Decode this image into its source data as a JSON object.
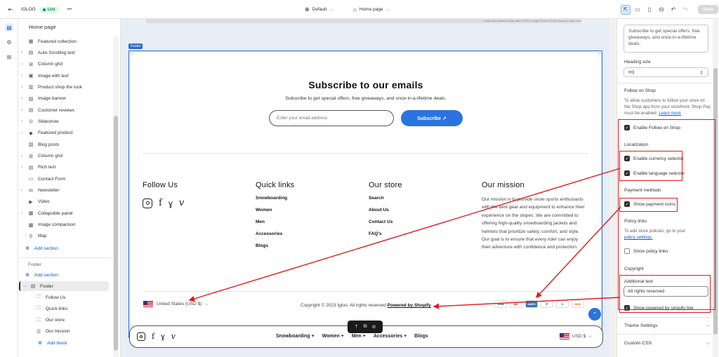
{
  "topbar": {
    "store_name": "IGLOO",
    "live_label": "Live",
    "more": "•••",
    "theme_label": "Default",
    "page_label": "Home page",
    "save_label": "Save"
  },
  "left_panel": {
    "title": "Home page",
    "items": [
      {
        "label": "Featured collection",
        "icon": "collection-icon",
        "glyph": "▦",
        "expandable": false
      },
      {
        "label": "Auto-Scrolling text",
        "icon": "text-icon",
        "glyph": "▤",
        "expandable": true
      },
      {
        "label": "Column grid",
        "icon": "grid-icon",
        "glyph": "⊞",
        "expandable": true
      },
      {
        "label": "Image with text",
        "icon": "image-text-icon",
        "glyph": "▣",
        "expandable": true
      },
      {
        "label": "Product shop the look",
        "icon": "product-icon",
        "glyph": "▥",
        "expandable": true
      },
      {
        "label": "Image banner",
        "icon": "image-icon",
        "glyph": "▨",
        "expandable": true
      },
      {
        "label": "Customer reviews",
        "icon": "reviews-icon",
        "glyph": "▤",
        "expandable": true
      },
      {
        "label": "Slideshow",
        "icon": "slideshow-icon",
        "glyph": "◎",
        "expandable": true
      },
      {
        "label": "Featured product",
        "icon": "tag-icon",
        "glyph": "◆",
        "expandable": true
      },
      {
        "label": "Blog posts",
        "icon": "blog-icon",
        "glyph": "▧",
        "expandable": false
      },
      {
        "label": "Column grid",
        "icon": "grid-icon",
        "glyph": "⊞",
        "expandable": true
      },
      {
        "label": "Rich text",
        "icon": "richtext-icon",
        "glyph": "▤",
        "expandable": true
      },
      {
        "label": "Contact Form",
        "icon": "form-icon",
        "glyph": "▭",
        "expandable": false
      },
      {
        "label": "Newsletter",
        "icon": "mail-icon",
        "glyph": "✉",
        "expandable": true
      },
      {
        "label": "Video",
        "icon": "video-icon",
        "glyph": "▶",
        "expandable": false
      },
      {
        "label": "Collapsible panel",
        "icon": "panel-icon",
        "glyph": "▦",
        "expandable": true
      },
      {
        "label": "Image comparison",
        "icon": "compare-icon",
        "glyph": "▩",
        "expandable": false
      },
      {
        "label": "Map",
        "icon": "map-pin-icon",
        "glyph": "⚲",
        "expandable": false
      }
    ],
    "add_section": "Add section",
    "footer_group_label": "Footer",
    "footer_add_section": "Add section",
    "footer_item": "Footer",
    "footer_blocks": [
      "Follow Us",
      "Quick links",
      "Our store",
      "Our mission"
    ],
    "add_block": "Add block"
  },
  "preview": {
    "map_attribution": "Keyboard shortcuts   Map data ©2023 Google   Terms of Use   Report a map error",
    "footer_tag": "Footer",
    "subscribe_title": "Subscribe to our emails",
    "subscribe_desc": "Subscribe to get special offers, free giveaways, and once-in-a-lifetime deals.",
    "email_placeholder": "Enter your email address",
    "subscribe_button": "Subscribe",
    "subscribe_arrow": "↗",
    "follow_heading": "Follow Us",
    "quick_links_heading": "Quick links",
    "quick_links": [
      "Snowboarding",
      "Women",
      "Men",
      "Accessories",
      "Blogs"
    ],
    "store_heading": "Our store",
    "store_links": [
      "Search",
      "About Us",
      "Contact Us",
      "FAQ's"
    ],
    "mission_heading": "Our mission",
    "mission_text": "Our mission is to provide snow sports enthusiasts with the best gear and equipment to enhance their experience on the slopes. We are committed to offering high-quality snowboarding jackets and helmets that prioritize safety, comfort, and style. Our goal is to ensure that every rider can enjoy their adventure with confidence and protection.",
    "currency_selector": "United States (USD $)",
    "copyright_prefix": "Copyright © 2023 Igloo. All rights reserved",
    "powered_by": "Powered by Shopify",
    "payment_icons": [
      "VISA",
      "MC",
      "AMEX",
      "P",
      "D",
      "DISC"
    ],
    "bottom_links": [
      "Snowboarding +",
      "Women +",
      "Men +",
      "Accessories +",
      "Blogs"
    ],
    "bottom_currency": "USD $"
  },
  "right_panel": {
    "description_text": "Subscribe to get special offers, free giveaways, and once-in-a-lifetime deals.",
    "heading_size_label": "Heading size",
    "heading_size_value": "H3",
    "follow_on_shop_title": "Follow on Shop",
    "follow_on_shop_desc": "To allow customers to follow your store on the Shop app from your storefront, Shop Pay must be enabled.",
    "learn_more": "Learn more",
    "enable_follow": "Enable Follow on Shop",
    "localization_title": "Localization",
    "enable_currency": "Enable currency selector",
    "enable_language": "Enable language selector",
    "payment_title": "Payment methods",
    "show_payment": "Show payment icons",
    "policy_title": "Policy links",
    "policy_desc": "To add store policies, go to your",
    "policy_link": "policy settings.",
    "show_policy": "Show policy links",
    "copyright_title": "Copyright",
    "additional_text_label": "Additional text",
    "additional_text_value": "All rights reserved",
    "show_powered": "Show powered by shopify link",
    "theme_settings": "Theme Settings",
    "custom_css": "Custom CSS"
  },
  "colors": {
    "accent": "#2b73e0",
    "annotation_red": "#e01b1b",
    "live_green": "#29845a"
  }
}
